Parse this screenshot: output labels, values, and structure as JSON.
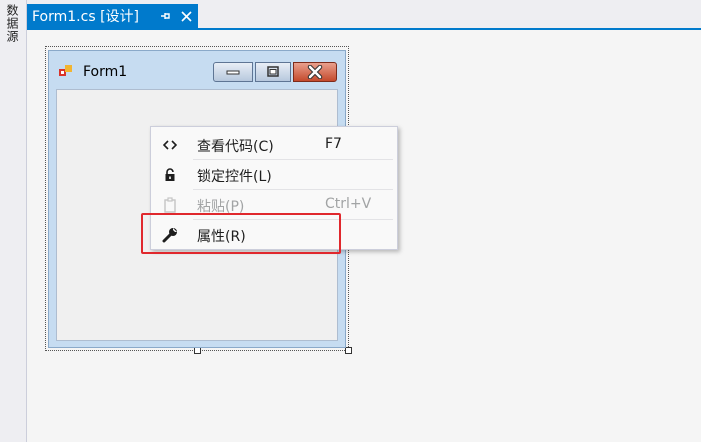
{
  "side_panel": {
    "label": "数据源"
  },
  "tab": {
    "title": "Form1.cs [设计]",
    "pin_icon": "pin-icon",
    "close_icon": "close-icon"
  },
  "form": {
    "title": "Form1",
    "icon": "form-app-icon",
    "buttons": [
      "minimize-icon",
      "maximize-icon",
      "close-icon"
    ]
  },
  "context_menu": {
    "items": [
      {
        "icon": "code-brackets-icon",
        "label": "查看代码(C)",
        "shortcut": "F7",
        "enabled": true
      },
      {
        "icon": "lock-icon",
        "label": "锁定控件(L)",
        "shortcut": "",
        "enabled": true
      },
      {
        "icon": "clipboard-icon",
        "label": "粘贴(P)",
        "shortcut": "Ctrl+V",
        "enabled": false
      },
      {
        "icon": "wrench-icon",
        "label": "属性(R)",
        "shortcut": "",
        "enabled": true
      }
    ]
  },
  "colors": {
    "accent": "#007acc",
    "highlight": "#e0282d",
    "form_frame": "#c6dcf1",
    "menu_background": "#f9f9f9"
  }
}
